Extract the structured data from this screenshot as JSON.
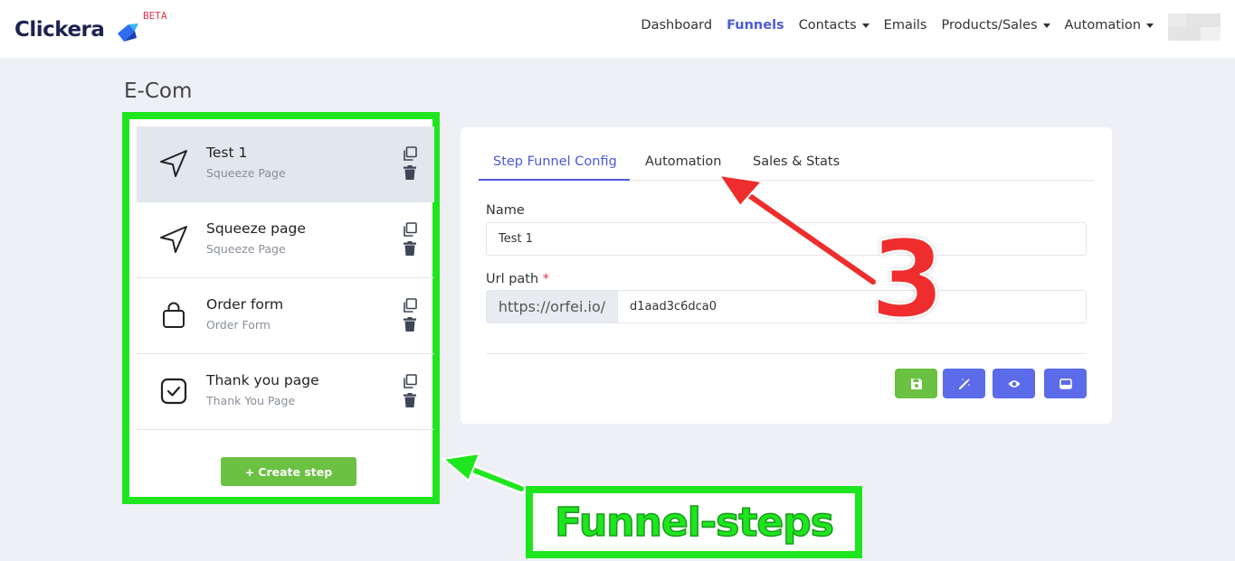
{
  "brand": {
    "name": "Clickera",
    "badge": "BETA"
  },
  "nav": [
    {
      "label": "Dashboard",
      "dropdown": false,
      "active": false
    },
    {
      "label": "Funnels",
      "dropdown": false,
      "active": true
    },
    {
      "label": "Contacts",
      "dropdown": true,
      "active": false
    },
    {
      "label": "Emails",
      "dropdown": false,
      "active": false
    },
    {
      "label": "Products/Sales",
      "dropdown": true,
      "active": false
    },
    {
      "label": "Automation",
      "dropdown": true,
      "active": false
    }
  ],
  "page": {
    "title": "E-Com"
  },
  "steps": [
    {
      "title": "Test 1",
      "subtitle": "Squeeze Page",
      "icon": "send-icon",
      "selected": true
    },
    {
      "title": "Squeeze page",
      "subtitle": "Squeeze Page",
      "icon": "send-icon",
      "selected": false
    },
    {
      "title": "Order form",
      "subtitle": "Order Form",
      "icon": "shopping-bag-icon",
      "selected": false
    },
    {
      "title": "Thank you page",
      "subtitle": "Thank You Page",
      "icon": "check-square-icon",
      "selected": false
    }
  ],
  "create_step_label": "Create step",
  "tabs": [
    {
      "label": "Step Funnel Config",
      "active": true
    },
    {
      "label": "Automation",
      "active": false
    },
    {
      "label": "Sales & Stats",
      "active": false
    }
  ],
  "form": {
    "name_label": "Name",
    "name_value": "Test 1",
    "url_label": "Url path",
    "url_required_mark": "*",
    "url_prefix": "https://orfei.io/",
    "url_value": "d1aad3c6dca0"
  },
  "actions": [
    {
      "icon": "save-icon",
      "color": "#6ac142"
    },
    {
      "icon": "magic-wand-icon",
      "color": "#5b6bea"
    },
    {
      "icon": "eye-icon",
      "color": "#5b6bea"
    },
    {
      "icon": "window-icon",
      "color": "#5b6bea"
    }
  ],
  "annotations": {
    "number": "3",
    "label": "Funnel-steps",
    "highlight_color": "#1ee61e",
    "arrow_color": "#ef2d2d"
  }
}
